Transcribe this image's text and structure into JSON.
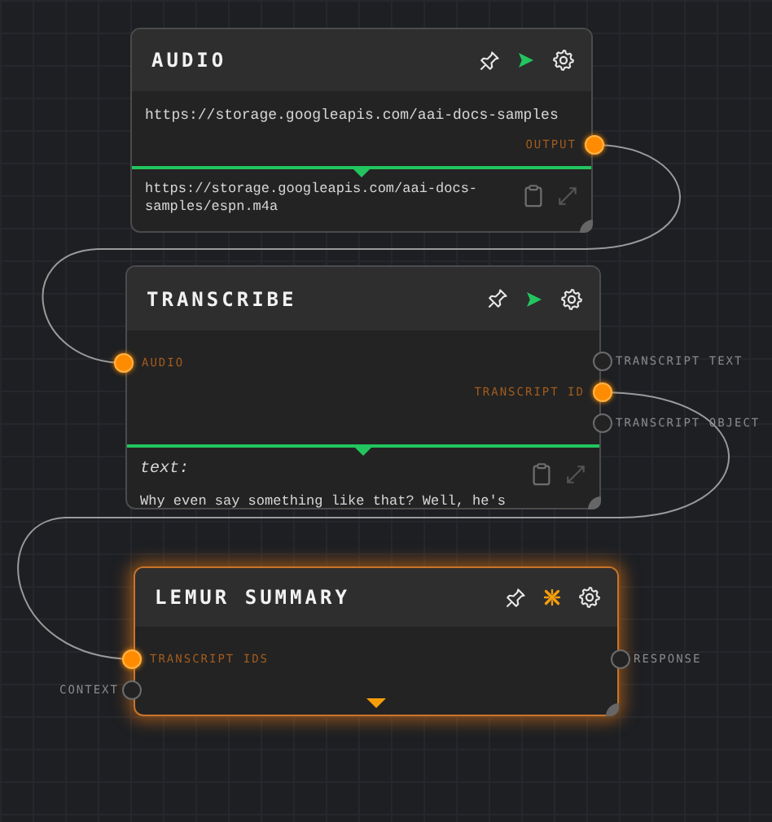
{
  "nodes": [
    {
      "title": "AUDIO",
      "running": false,
      "field": "https://storage.googleapis.com/aai-docs-samples",
      "output_text": "https://storage.googleapis.com/aai-docs-samples/espn.m4a",
      "ports": [
        {
          "label": "OUTPUT",
          "kind": "output",
          "connected": true
        }
      ]
    },
    {
      "title": "TRANSCRIBE",
      "running": false,
      "output_label": "text:",
      "output_text": "Why even say something like that? Well, he's",
      "ports": [
        {
          "label": "AUDIO",
          "kind": "input",
          "connected": true
        },
        {
          "label": "TRANSCRIPT TEXT",
          "kind": "output",
          "connected": false
        },
        {
          "label": "TRANSCRIPT ID",
          "kind": "output",
          "connected": true
        },
        {
          "label": "TRANSCRIPT OBJECT",
          "kind": "output",
          "connected": false
        }
      ]
    },
    {
      "title": "LEMUR SUMMARY",
      "running": true,
      "ports": [
        {
          "label": "TRANSCRIPT IDS",
          "kind": "input",
          "connected": true
        },
        {
          "label": "CONTEXT",
          "kind": "input",
          "connected": false
        },
        {
          "label": "RESPONSE",
          "kind": "output",
          "connected": false
        }
      ]
    }
  ]
}
